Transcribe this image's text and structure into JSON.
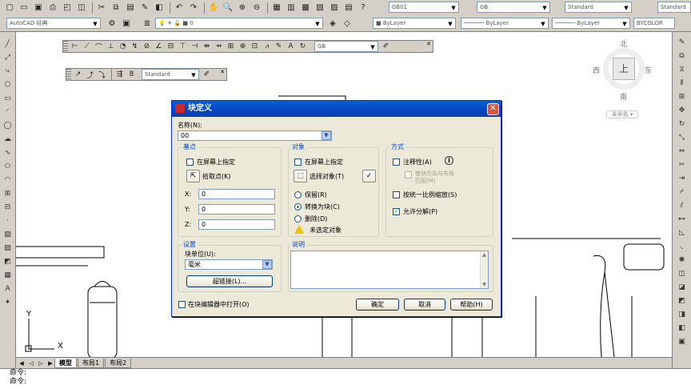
{
  "toolbar": {
    "workspace": "AutoCAD 经典",
    "layer_value": "0",
    "text_style": "GB01",
    "dim_style": "GB",
    "table_style": "Standard",
    "multileader_style": "Standard",
    "color": "ByLayer",
    "linetype": "ByLayer",
    "lineweight": "ByLayer",
    "plot_style": "BYCOLOR"
  },
  "dim_toolbar": {
    "style": "GB"
  },
  "mleader_toolbar": {
    "style": "Standard"
  },
  "viewcube": {
    "north": "北",
    "south": "南",
    "east": "东",
    "west": "西",
    "top": "上",
    "wcs": "未命名"
  },
  "tabs": [
    "模型",
    "布局1",
    "布局2"
  ],
  "command_lines": [
    "命令:",
    "命令:"
  ],
  "dialog": {
    "title": "块定义",
    "name_label": "名称(N):",
    "name_value": "00",
    "base": {
      "title": "基点",
      "on_screen": "在屏幕上指定",
      "pick": "拾取点(K)",
      "x_label": "X:",
      "x": "0",
      "y_label": "Y:",
      "y": "0",
      "z_label": "Z:",
      "z": "0"
    },
    "objects": {
      "title": "对象",
      "on_screen": "在屏幕上指定",
      "select": "选择对象(T)",
      "retain": "保留(R)",
      "convert": "转换为块(C)",
      "delete": "删除(D)",
      "warning": "未选定对象"
    },
    "behavior": {
      "title": "方式",
      "annotative": "注释性(A)",
      "match_line1": "使块方向与布局",
      "match_line2": "匹配(M)",
      "scale_uniform": "按统一比例缩放(S)",
      "allow_explode": "允许分解(P)"
    },
    "settings": {
      "title": "设置",
      "unit_label": "块单位(U):",
      "unit_value": "毫米",
      "hyperlink": "超链接(L)..."
    },
    "description": {
      "title": "说明"
    },
    "open_in_editor": "在块编辑器中打开(O)",
    "ok": "确定",
    "cancel": "取消",
    "help": "帮助(H)"
  }
}
